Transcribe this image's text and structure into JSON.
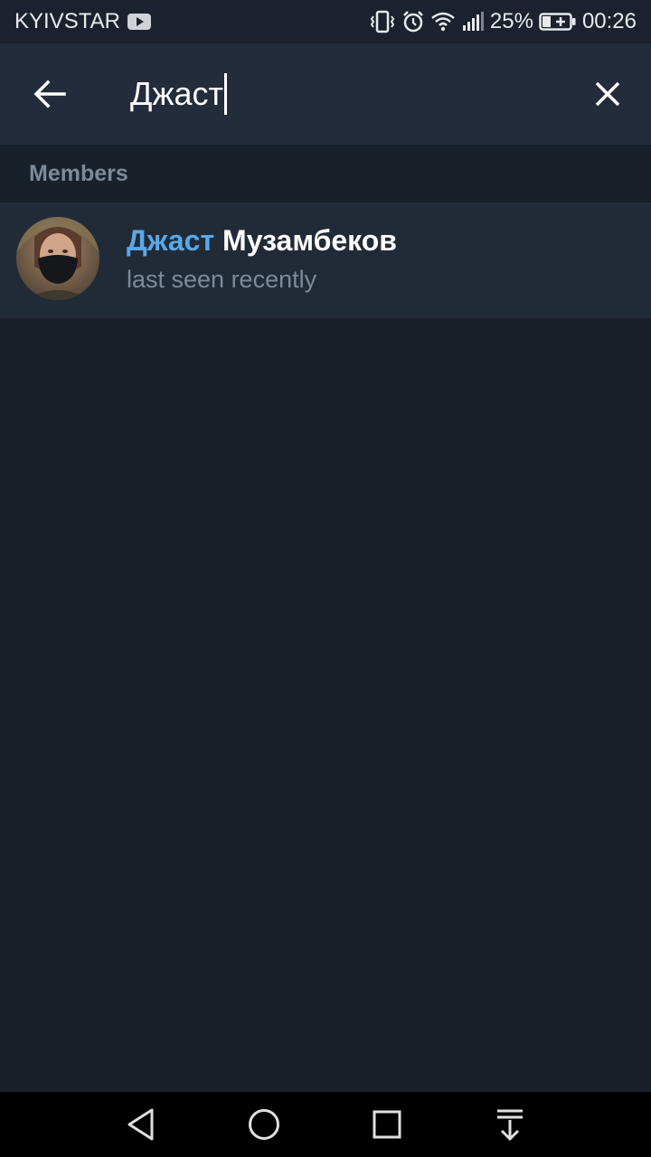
{
  "status_bar": {
    "carrier": "KYIVSTAR",
    "battery": "25%",
    "time": "00:26",
    "icons": [
      "youtube-icon",
      "vibrate-icon",
      "alarm-icon",
      "wifi-icon",
      "signal-icon",
      "battery-charging-icon"
    ]
  },
  "search": {
    "query": "Джаст",
    "back_icon": "arrow-left-icon",
    "clear_icon": "close-icon"
  },
  "section": {
    "title": "Members"
  },
  "results": [
    {
      "name_match": "Джаст",
      "name_rest": " Музамбеков",
      "status": "last seen recently"
    }
  ],
  "colors": {
    "header_bg": "#222c3b",
    "body_bg": "#1a202a",
    "row_bg": "#212b38",
    "accent": "#5aa8e8",
    "muted": "#7d8a99"
  },
  "navigation": {
    "buttons": [
      "back-triangle-icon",
      "home-circle-icon",
      "recents-square-icon",
      "notification-pull-icon"
    ]
  }
}
